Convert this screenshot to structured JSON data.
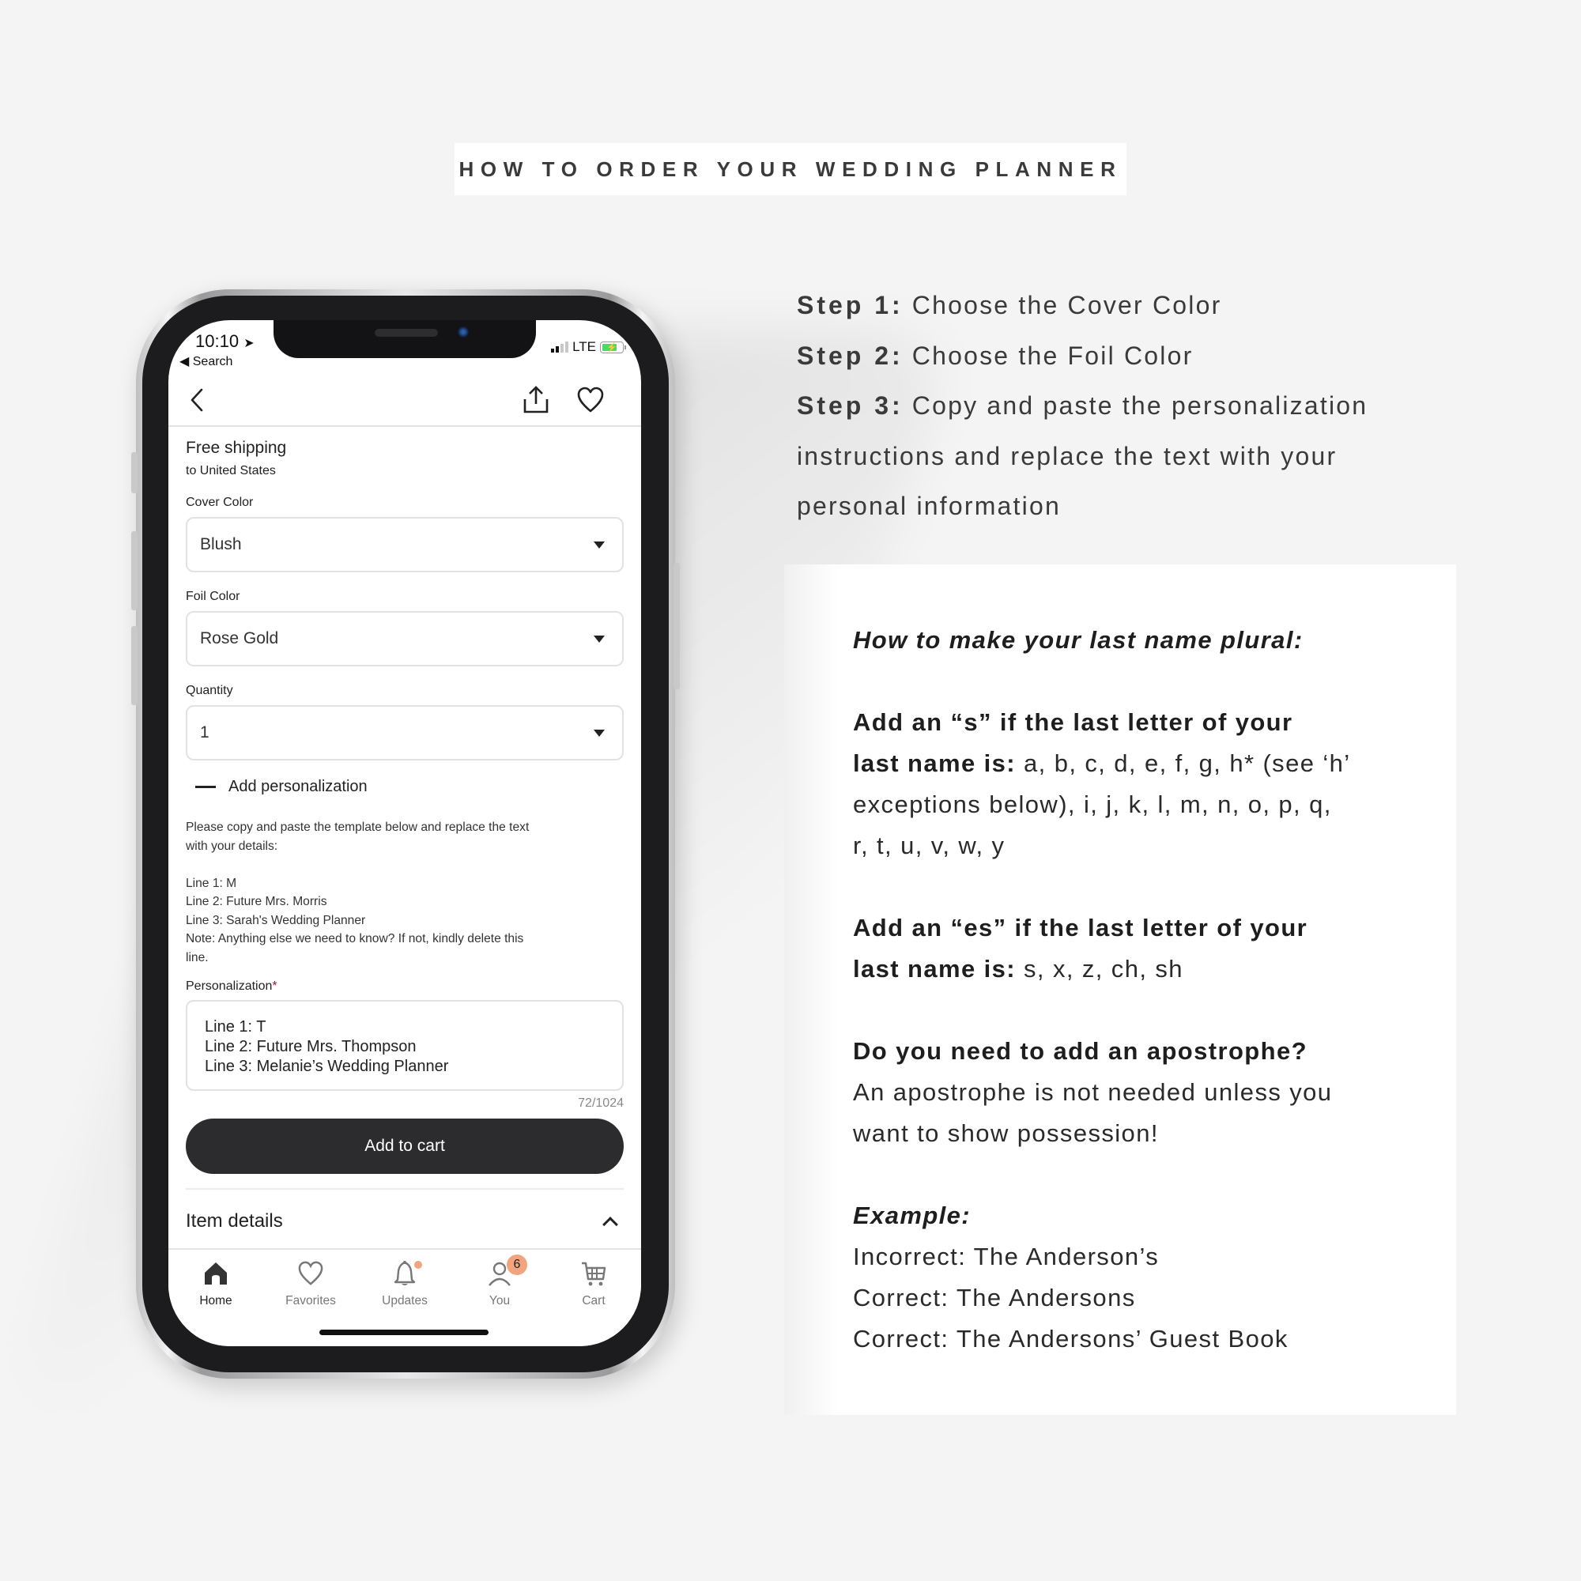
{
  "page_title": "HOW TO ORDER YOUR WEDDING PLANNER",
  "steps": [
    {
      "label": "Step 1:",
      "text": "Choose the Cover Color"
    },
    {
      "label": "Step 2:",
      "text": "Choose the Foil Color"
    },
    {
      "label": "Step 3:",
      "text": "Copy and paste the personalization"
    },
    {
      "label": "",
      "text": "instructions and replace the text with your"
    },
    {
      "label": "",
      "text": "personal information"
    }
  ],
  "plural_card": {
    "heading": "How to make your last name plural:",
    "rule_s_bold_1": "Add an “s” if the last letter of your",
    "rule_s_bold_2": "last name is:",
    "rule_s_letters_1": " a, b, c, d, e, f, g, h* (see ‘h’",
    "rule_s_letters_2": "exceptions below), i, j, k, l, m, n, o, p, q,",
    "rule_s_letters_3": "r, t, u, v, w, y",
    "rule_es_bold_1": "Add an “es” if the last letter of your",
    "rule_es_bold_2": "last name is:",
    "rule_es_letters": " s, x, z, ch, sh",
    "apostrophe_heading": "Do you need to add an apostrophe?",
    "apostrophe_text_1": "An apostrophe is not needed unless you",
    "apostrophe_text_2": "want to show possession!",
    "example_heading": "Example:",
    "examples": [
      "Incorrect: The Anderson’s",
      "Correct: The Andersons",
      "Correct: The Andersons’ Guest Book"
    ]
  },
  "phone": {
    "status": {
      "time": "10:10",
      "back_label": "◀ Search",
      "network": "LTE"
    },
    "header": {
      "back_icon": "chevron-left-icon",
      "share_icon": "share-icon",
      "favorite_icon": "heart-icon"
    },
    "shipping": {
      "title": "Free shipping",
      "prefix": "to ",
      "destination": "United States"
    },
    "cover_color": {
      "label": "Cover Color",
      "value": "Blush"
    },
    "foil_color": {
      "label": "Foil Color",
      "value": "Rose Gold"
    },
    "quantity": {
      "label": "Quantity",
      "value": "1"
    },
    "personalization_toggle": "Add personalization",
    "instructions": [
      "Please copy and paste the template below and replace the text",
      "with your details:",
      "",
      "Line 1: M",
      "Line 2: Future Mrs. Morris",
      "Line 3: Sarah's Wedding Planner",
      "Note: Anything else we need to know? If not, kindly delete this",
      "line."
    ],
    "personalization": {
      "label": "Personalization",
      "required_mark": "*",
      "lines": [
        "Line 1: T",
        "Line 2: Future Mrs. Thompson",
        "Line 3: Melanie’s Wedding Planner"
      ],
      "counter": "72/1024"
    },
    "add_to_cart": "Add to cart",
    "item_details": "Item details",
    "tabs": [
      {
        "label": "Home",
        "icon": "home-icon",
        "active": true
      },
      {
        "label": "Favorites",
        "icon": "heart-icon"
      },
      {
        "label": "Updates",
        "icon": "bell-icon",
        "dot": true
      },
      {
        "label": "You",
        "icon": "user-icon",
        "badge": "6"
      },
      {
        "label": "Cart",
        "icon": "cart-icon"
      }
    ]
  },
  "colors": {
    "background": "#f4f4f4",
    "button_dark": "#2c2c2e",
    "badge": "#f1a47d",
    "required": "#a3193a"
  }
}
